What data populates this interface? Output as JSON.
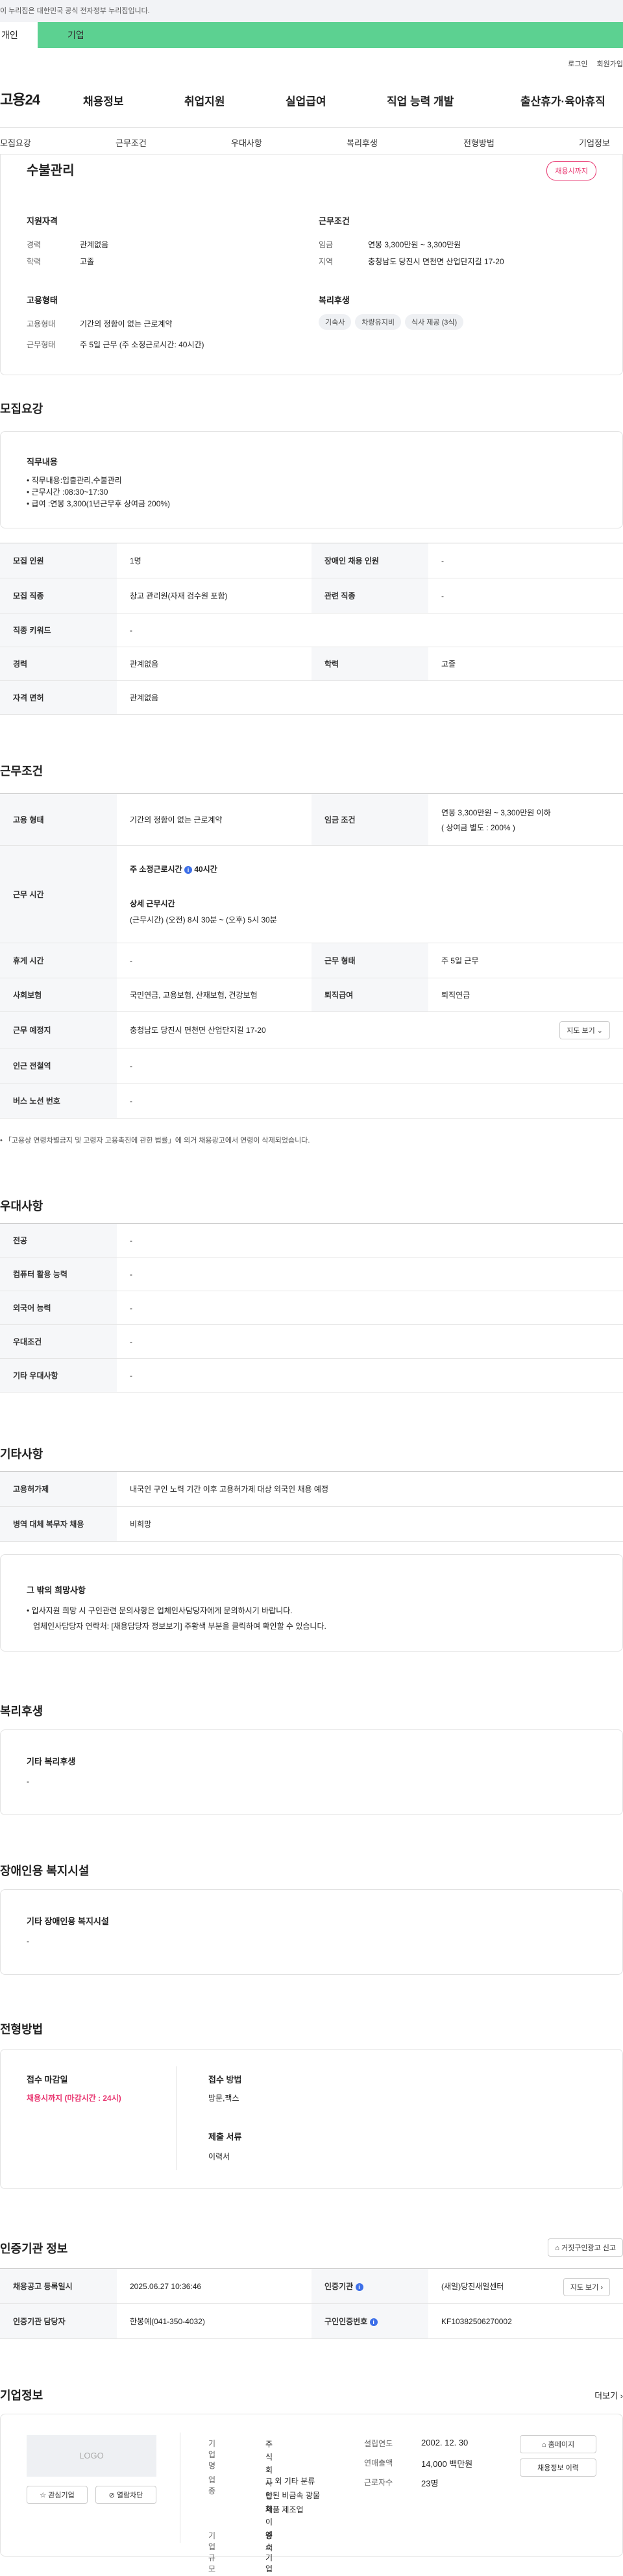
{
  "gov_banner": "이 누리집은 대한민국 공식 전자정부 누리집입니다.",
  "tabs": {
    "person": "개인",
    "business": "기업"
  },
  "util": {
    "login": "로그인",
    "join": "회원가입"
  },
  "gnb": {
    "logo": "고용24",
    "menu": [
      "채용정보",
      "취업지원",
      "실업급여",
      "직업 능력 개발",
      "출산휴가·육아휴직"
    ]
  },
  "lnb": [
    "모집요강",
    "근무조건",
    "우대사항",
    "복리후생",
    "전형방법",
    "기업정보"
  ],
  "summary": {
    "title": "수불관리",
    "badge": "채용시까지",
    "qualify_title": "지원자격",
    "qualify": [
      {
        "k": "경력",
        "v": "관계없음"
      },
      {
        "k": "학력",
        "v": "고졸"
      }
    ],
    "cond_title": "근무조건",
    "cond": [
      {
        "k": "임금",
        "v": "연봉 3,300만원 ~ 3,300만원"
      },
      {
        "k": "지역",
        "v": "충청남도 당진시 면천면 산업단지길 17-20"
      }
    ],
    "emp_title": "고용형태",
    "emp": [
      {
        "k": "고용형태",
        "v": "기간의 정함이 없는 근로계약"
      },
      {
        "k": "근무형태",
        "v": "주 5일 근무 (주 소정근로시간: 40시간)"
      }
    ],
    "welfare_title": "복리후생",
    "welfare": [
      "기숙사",
      "차량유지비",
      "식사 제공 (3식)"
    ]
  },
  "recruit": {
    "h": "모집요강",
    "job_title": "직무내용",
    "job_lines": [
      "• 직무내용:입출관리,수불관리",
      "• 근무시간 :08:30~17:30",
      "• 급여 :연봉 3,300(1년근무후 상여금 200%)"
    ],
    "rows": [
      {
        "k1": "모집 인원",
        "v1": "1명",
        "k2": "장애인 채용 인원",
        "v2": "-"
      },
      {
        "k1": "모집 직종",
        "v1": "창고 관리원(자재 검수원 포함)",
        "k2": "관련 직종",
        "v2": "-"
      },
      {
        "k1": "직종 키워드",
        "v1": "-"
      },
      {
        "k1": "경력",
        "v1": "관계없음",
        "k2": "학력",
        "v2": "고졸"
      },
      {
        "k1": "자격 면허",
        "v1": "관계없음"
      }
    ]
  },
  "work": {
    "h": "근무조건",
    "emp_k": "고용 형태",
    "emp_v": "기간의 정함이 없는 근로계약",
    "wage_k": "임금 조건",
    "wage_v1": "연봉 3,300만원 ~ 3,300만원 이하",
    "wage_v2": "( 상여금 별도 : 200% )",
    "time_k": "근무 시간",
    "time_l1": "주 소정근로시간",
    "time_l1b": "40시간",
    "time_l2": "상세 근무시간",
    "time_l3": "(근무시간) (오전) 8시 30분 ~ (오후) 5시 30분",
    "rest_k": "휴게 시간",
    "rest_v": "-",
    "type_k": "근무 형태",
    "type_v": "주 5일 근무",
    "ins_k": "사회보험",
    "ins_v": "국민연금, 고용보험, 산재보험, 건강보험",
    "ret_k": "퇴직급여",
    "ret_v": "퇴직연금",
    "loc_k": "근무 예정지",
    "loc_v": "충청남도 당진시 면천면 산업단지길 17-20",
    "map_btn": "지도 보기",
    "sub_k": "인근 전철역",
    "sub_v": "-",
    "bus_k": "버스 노선 번호",
    "bus_v": "-",
    "note": "「고용상 연령차별금지 및 고령자 고용촉진에 관한 법률」에 의거 채용광고에서 연령이 삭제되었습니다."
  },
  "pref": {
    "h": "우대사항",
    "rows": [
      {
        "k": "전공",
        "v": "-"
      },
      {
        "k": "컴퓨터 활용 능력",
        "v": "-"
      },
      {
        "k": "외국어 능력",
        "v": "-"
      },
      {
        "k": "우대조건",
        "v": "-"
      },
      {
        "k": "기타 우대사항",
        "v": "-"
      }
    ]
  },
  "etc": {
    "h": "기타사항",
    "rows": [
      {
        "k": "고용허가제",
        "v": "내국인 구인 노력 기간 이후 고용허가제 대상 외국인 채용 예정"
      },
      {
        "k": "병역 대체 복무자 채용",
        "v": "비희망"
      }
    ],
    "hope_title": "그 밖의 희망사항",
    "hope_l1": "• 입사지원 희망 시 구인관련 문의사항은 업체인사담당자에게 문의하시기 바랍니다.",
    "hope_l2": "업체인사담당자 연락처: [채용담당자 정보보기] 주황색 부분을 클릭하여 확인할 수 있습니다."
  },
  "welfare": {
    "h": "복리후생",
    "title": "기타 복리후생",
    "v": "-"
  },
  "disab": {
    "h": "장애인용 복지시설",
    "title": "기타 장애인용 복지시설",
    "v": "-"
  },
  "select": {
    "h": "전형방법",
    "deadline_k": "접수 마감일",
    "deadline_v": "채용시까지 (마감시간 : 24시)",
    "method_k": "접수 방법",
    "method_v": "방문,팩스",
    "docs_k": "제출 서류",
    "docs_v": "이력서"
  },
  "cert": {
    "h": "인증기관 정보",
    "report_btn": "거짓구인광고 신고",
    "rows": [
      {
        "k1": "채용공고 등록일시",
        "v1": "2025.06.27 10:36:46",
        "k2": "인증기관",
        "v2": "(새일)당진새일센터"
      },
      {
        "k1": "인증기관 담당자",
        "v1": "한봉예(041-350-4032)",
        "k2": "구인인증번호",
        "v2": "KF10382506270002"
      }
    ],
    "map_btn": "지도 보기"
  },
  "company": {
    "h": "기업정보",
    "more": "더보기",
    "logo": "LOGO",
    "fav_btn": "관심기업",
    "block_btn": "열람차단",
    "name_k": "기업명",
    "name_v1": "주식회사성화이엔",
    "name_v2": "씨",
    "ind_k": "업종",
    "ind_v1": "그 외 기타 분류",
    "ind_v2": "안된 비금속 광물",
    "ind_v3": "제품 제조업",
    "size_k": "기업규모",
    "size_v": "중소기업",
    "est_k": "설립연도",
    "est_v": "2002. 12. 30",
    "sales_k": "연매출액",
    "sales_v": "14,000 백만원",
    "emp_k": "근로자수",
    "emp_v": "23명",
    "home_btn": "홈페이지",
    "hist_btn": "채용정보 이력"
  }
}
